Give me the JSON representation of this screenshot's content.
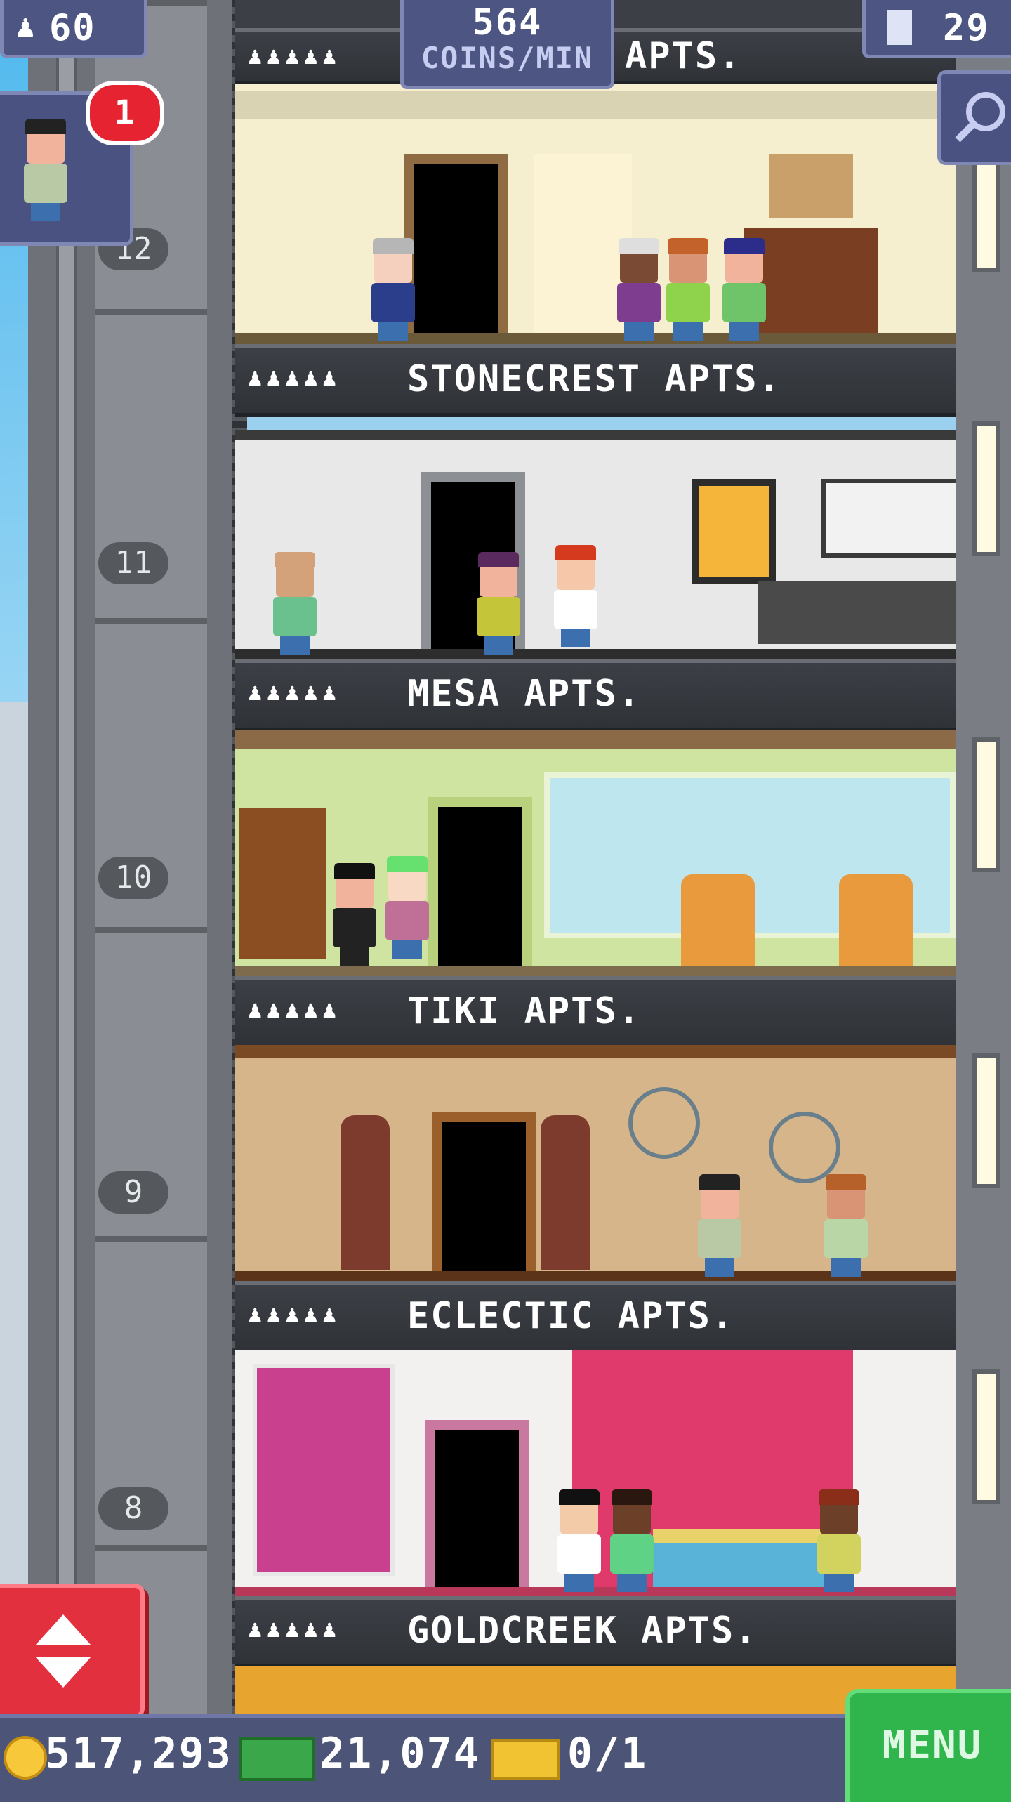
{
  "hud": {
    "population": "60",
    "coins_per_min_value": "564",
    "coins_per_min_unit": "COINS/MIN",
    "floor_count": "29",
    "visitor_notification_count": "1",
    "top_partial_label": "APTS."
  },
  "bottom_bar": {
    "coins": "517,293",
    "bux": "21,074",
    "tickets": "0/1",
    "menu_label": "MENU"
  },
  "floor_numbers": [
    "12",
    "11",
    "10",
    "9",
    "8"
  ],
  "floors": [
    {
      "number": "12",
      "name": "STONECREST APTS."
    },
    {
      "number": "11",
      "name": "MESA APTS."
    },
    {
      "number": "10",
      "name": "TIKI APTS."
    },
    {
      "number": "9",
      "name": "ECLECTIC APTS."
    },
    {
      "number": "8",
      "name": "GOLDCREEK APTS."
    }
  ],
  "rating_stars": "♟♟♟♟♟",
  "colors": {
    "hud_blue": "#4d5583",
    "menu_green": "#2fb54c",
    "elevator_red": "#e3303e",
    "label_bar": "#34373c"
  },
  "icons": {
    "population": "person-icon",
    "floors": "building-icon",
    "search": "magnifier-icon",
    "coins": "coin-icon",
    "bux": "bux-icon",
    "tickets": "ticket-icon",
    "elevator": "up-down-arrows-icon"
  }
}
